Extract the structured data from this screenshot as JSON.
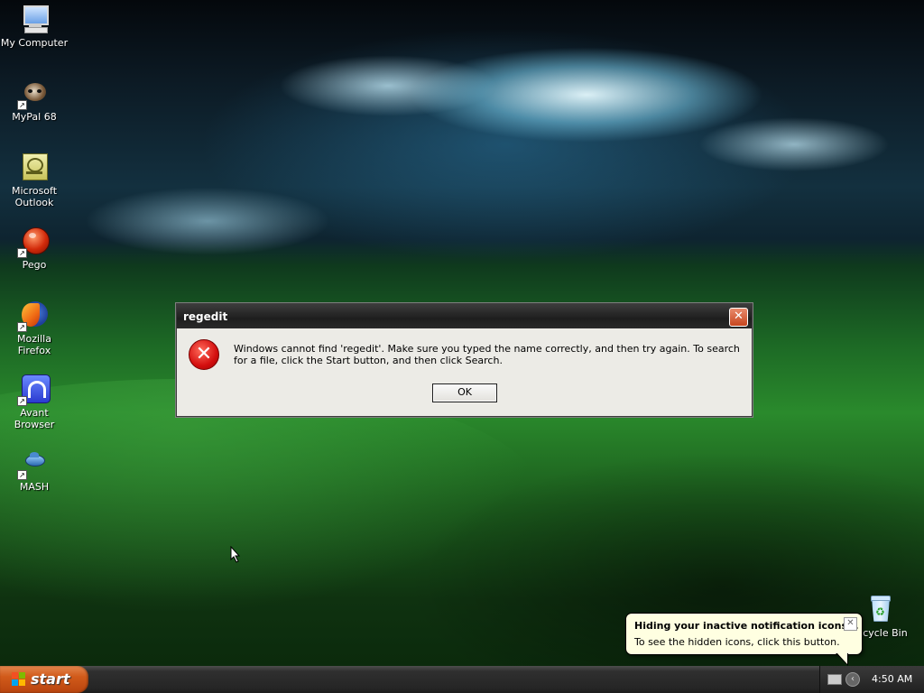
{
  "desktop": {
    "icons": [
      {
        "label": "My Computer"
      },
      {
        "label": "MyPal 68"
      },
      {
        "label": "Microsoft Outlook"
      },
      {
        "label": "Pego"
      },
      {
        "label": "Mozilla Firefox"
      },
      {
        "label": "Avant Browser"
      },
      {
        "label": "MASH"
      },
      {
        "label": "Recycle Bin"
      }
    ]
  },
  "dialog": {
    "title": "regedit",
    "close_glyph": "✕",
    "icon": "error-icon",
    "message": "Windows cannot find 'regedit'. Make sure you typed the name correctly, and then try again. To search for a file, click the Start button, and then click Search.",
    "ok_label": "OK"
  },
  "balloon": {
    "title": "Hiding your inactive notification icons...",
    "text": "To see the hidden icons, click this button.",
    "close_glyph": "✕"
  },
  "taskbar": {
    "start_label": "start",
    "clock": "4:50 AM"
  },
  "colors": {
    "start_button": "#d15a1a",
    "taskbar": "#262626",
    "dialog_title": "#1e1e1e",
    "balloon_bg": "#ffffe1"
  }
}
